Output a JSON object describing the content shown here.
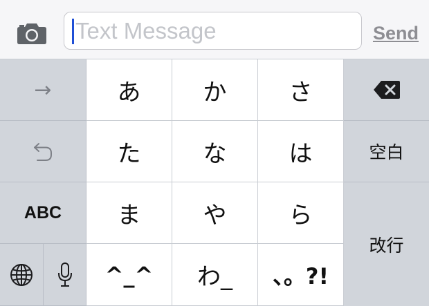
{
  "message_bar": {
    "camera_icon": "camera-icon",
    "placeholder": "Text Message",
    "send_label": "Send"
  },
  "keyboard": {
    "left_column": {
      "next_candidate": "→",
      "undo_icon": "undo-icon",
      "abc_label": "ABC",
      "globe_icon": "globe-icon",
      "mic_icon": "microphone-icon"
    },
    "kana_keys": [
      "あ",
      "か",
      "さ",
      "た",
      "な",
      "は",
      "ま",
      "や",
      "ら",
      "^_^",
      "わ_",
      "、。?!"
    ],
    "right_column": {
      "delete_icon": "delete-icon",
      "space_label": "空白",
      "return_label": "改行"
    }
  }
}
